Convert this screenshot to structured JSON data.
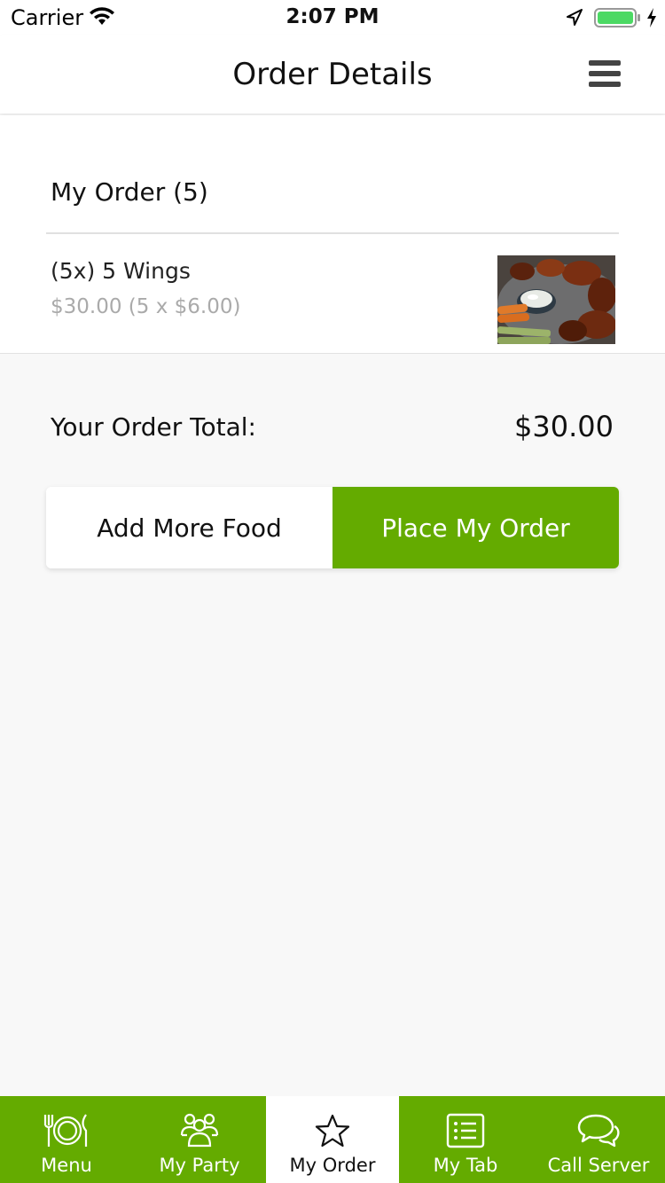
{
  "status_bar": {
    "carrier": "Carrier",
    "time": "2:07 PM"
  },
  "nav": {
    "title": "Order Details"
  },
  "order": {
    "heading": "My Order (5)",
    "items": [
      {
        "name": "(5x) 5 Wings",
        "price": "$30.00 (5 x $6.00)",
        "image": "wings-photo"
      }
    ]
  },
  "total": {
    "label": "Your Order Total:",
    "value": "$30.00"
  },
  "buttons": {
    "add_more": "Add More Food",
    "place_order": "Place My Order"
  },
  "tabs": [
    {
      "label": "Menu",
      "icon": "utensils-plate-icon",
      "active": false
    },
    {
      "label": "My Party",
      "icon": "group-icon",
      "active": false
    },
    {
      "label": "My Order",
      "icon": "star-icon",
      "active": true
    },
    {
      "label": "My Tab",
      "icon": "list-icon",
      "active": false
    },
    {
      "label": "Call Server",
      "icon": "chat-bubbles-icon",
      "active": false
    }
  ],
  "colors": {
    "accent": "#64ab00",
    "battery": "#4cd964"
  }
}
